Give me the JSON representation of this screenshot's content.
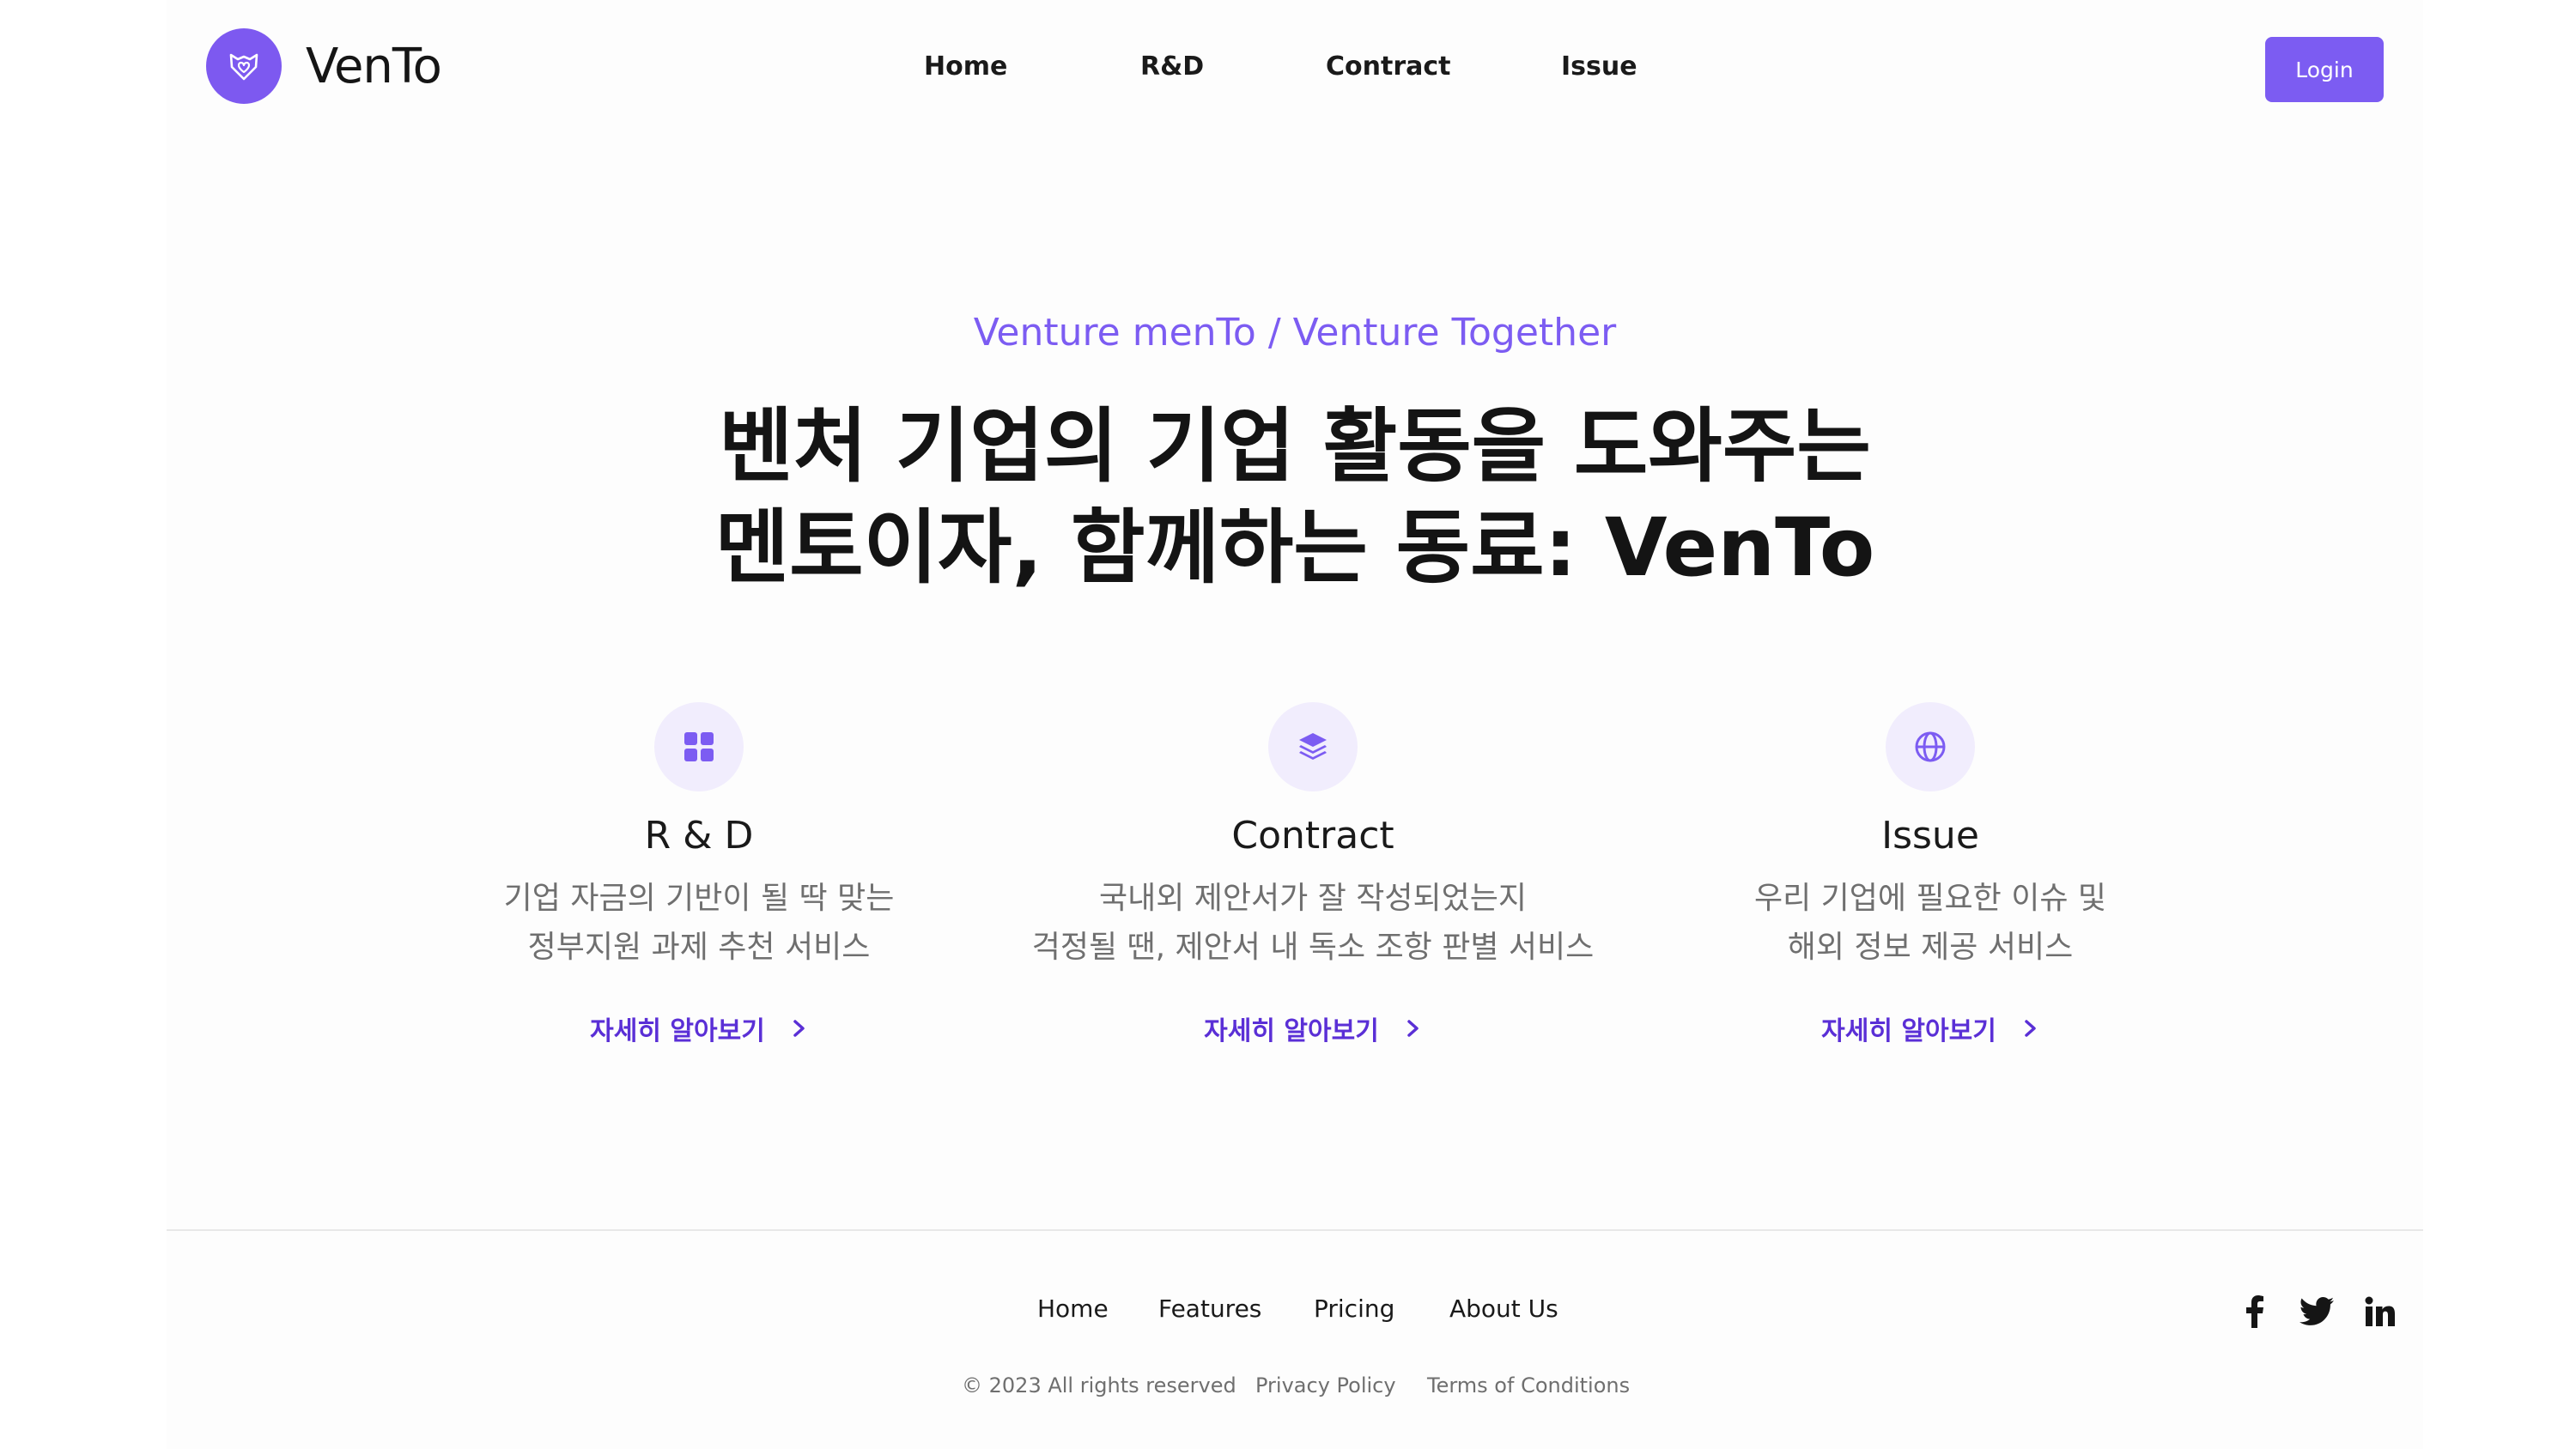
{
  "brand": {
    "name": "VenTo",
    "accent_color": "#7c5cf2",
    "logo_icon": "fox-heart-logo-icon"
  },
  "nav": {
    "items": [
      "Home",
      "R&D",
      "Contract",
      "Issue"
    ],
    "login_label": "Login"
  },
  "hero": {
    "subtitle": "Venture menTo / Venture Together",
    "title_line1": "벤처 기업의 기업 활동을 도와주는",
    "title_line2": "멘토이자, 함께하는 동료: VenTo"
  },
  "features": [
    {
      "icon": "grid-icon",
      "title": "R & D",
      "desc_line1": "기업 자금의 기반이 될 딱 맞는",
      "desc_line2": "정부지원 과제 추천 서비스",
      "link_label": "자세히 알아보기"
    },
    {
      "icon": "layers-icon",
      "title": "Contract",
      "desc_line1": "국내외 제안서가 잘 작성되었는지",
      "desc_line2": "걱정될 땐, 제안서 내 독소 조항 판별 서비스",
      "link_label": "자세히 알아보기"
    },
    {
      "icon": "globe-icon",
      "title": "Issue",
      "desc_line1": "우리 기업에 필요한 이슈 및",
      "desc_line2": "해외 정보 제공 서비스",
      "link_label": "자세히 알아보기"
    }
  ],
  "footer": {
    "nav": [
      "Home",
      "Features",
      "Pricing",
      "About Us"
    ],
    "copyright": "© 2023 All rights reserved",
    "privacy": "Privacy Policy",
    "terms": "Terms of Conditions",
    "social_icons": [
      "facebook-icon",
      "twitter-icon",
      "linkedin-icon"
    ]
  }
}
